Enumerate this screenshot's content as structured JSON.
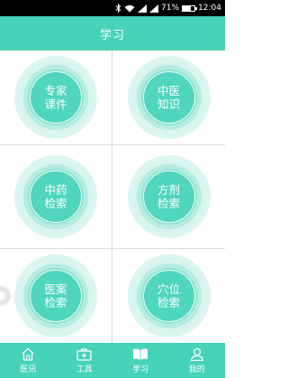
{
  "status_bar": {
    "battery_percent_text": "71%",
    "battery_level": 0.71,
    "time": "12:04"
  },
  "header": {
    "title": "学习"
  },
  "tiles": [
    {
      "label": "专家\n课件"
    },
    {
      "label": "中医\n知识"
    },
    {
      "label": "中药\n检索"
    },
    {
      "label": "方剂\n检索"
    },
    {
      "label": "医案\n检索"
    },
    {
      "label": "穴位\n检索"
    }
  ],
  "bottom_nav": {
    "items": [
      {
        "label": "医讯",
        "icon": "home-icon"
      },
      {
        "label": "工具",
        "icon": "medical-kit-icon"
      },
      {
        "label": "学习",
        "icon": "book-icon"
      },
      {
        "label": "我的",
        "icon": "person-icon"
      }
    ]
  },
  "colors": {
    "primary": "#46d3b8",
    "tile_core": "#4fd6bc",
    "divider": "#d9d9d9"
  }
}
